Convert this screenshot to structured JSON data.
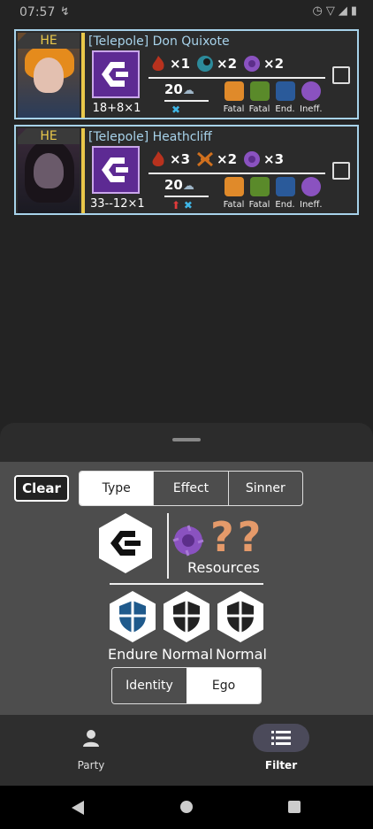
{
  "status_bar": {
    "time": "07:57"
  },
  "cards": [
    {
      "grade": "HE",
      "skill_name": "[Telepole] Don Quixote",
      "power": "18+8×1",
      "resources": [
        {
          "icon": "wrath-icon",
          "count": "×1",
          "color": "#b8321e"
        },
        {
          "icon": "gloom-icon",
          "count": "×2",
          "color": "#2c8a9a"
        },
        {
          "icon": "envy-icon",
          "count": "×2",
          "color": "#8a52c0"
        }
      ],
      "weight": "20",
      "status_marks": [
        "x"
      ],
      "res_types": [
        "Fatal",
        "Fatal",
        "End.",
        "Ineff."
      ]
    },
    {
      "grade": "HE",
      "skill_name": "[Telepole] Heathcliff",
      "power": "33--12×1",
      "resources": [
        {
          "icon": "wrath-icon",
          "count": "×3",
          "color": "#b8321e"
        },
        {
          "icon": "sloth-icon",
          "count": "×2",
          "color": "#d0701e"
        },
        {
          "icon": "envy-icon",
          "count": "×3",
          "color": "#8a52c0"
        }
      ],
      "weight": "20",
      "status_marks": [
        "up",
        "x"
      ],
      "res_types": [
        "Fatal",
        "Fatal",
        "End.",
        "Ineff."
      ]
    }
  ],
  "filter": {
    "clear_label": "Clear",
    "tabs": [
      "Type",
      "Effect",
      "Sinner"
    ],
    "active_tab": "Type",
    "question_marks": "??",
    "resources_label": "Resources",
    "shields": [
      {
        "label": "Endure",
        "color": "#1f5a8c"
      },
      {
        "label": "Normal",
        "color": "#222222"
      },
      {
        "label": "Normal",
        "color": "#222222"
      }
    ],
    "mode_tabs": [
      "Identity",
      "Ego"
    ],
    "active_mode": "Identity"
  },
  "bottom_nav": [
    {
      "label": "Party",
      "icon": "person-icon",
      "active": false
    },
    {
      "label": "Filter",
      "icon": "list-icon",
      "active": true
    }
  ]
}
